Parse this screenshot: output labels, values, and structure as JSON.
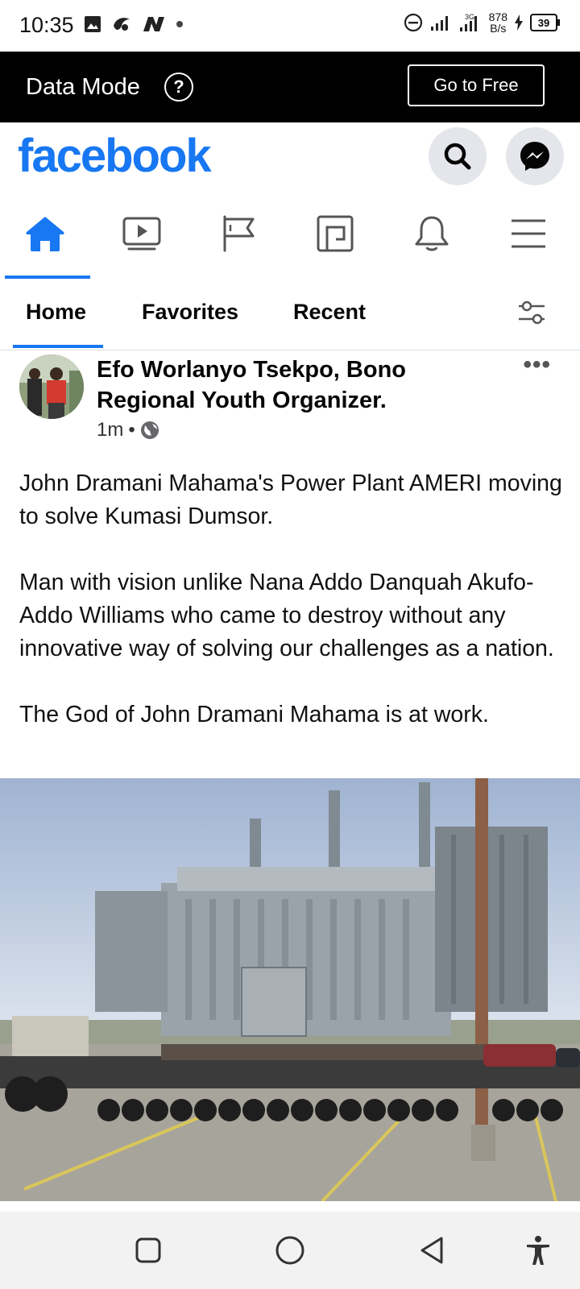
{
  "status_bar": {
    "time": "10:35",
    "network_speed": "878",
    "network_speed_unit": "B/s",
    "battery": "39",
    "signal_label": "3G"
  },
  "data_mode": {
    "label": "Data Mode",
    "help_symbol": "?",
    "button_label": "Go to Free"
  },
  "header": {
    "logo": "facebook",
    "search_icon": "search-icon",
    "messenger_icon": "messenger-icon",
    "brand_color": "#1877f2"
  },
  "nav_tabs": [
    {
      "name": "home",
      "icon": "home-icon",
      "active": true
    },
    {
      "name": "watch",
      "icon": "video-icon",
      "active": false
    },
    {
      "name": "pages",
      "icon": "flag-icon",
      "active": false
    },
    {
      "name": "feeds",
      "icon": "feeds-icon",
      "active": false
    },
    {
      "name": "notifications",
      "icon": "bell-icon",
      "active": false
    },
    {
      "name": "menu",
      "icon": "menu-icon",
      "active": false
    }
  ],
  "filters": {
    "items": [
      "Home",
      "Favorites",
      "Recent"
    ],
    "selected": "Home"
  },
  "post": {
    "author": "Efo Worlanyo Tsekpo, Bono Regional Youth Organizer.",
    "time": "1m",
    "separator": "•",
    "audience_icon": "globe-icon",
    "paragraphs": [
      "John Dramani Mahama's Power Plant AMERI moving to solve Kumasi Dumsor.",
      "Man with vision unlike Nana Addo Danquah Akufo-Addo Williams who came to destroy without any innovative way of solving our challenges as a nation.",
      "The God of John Dramani Mahama is at work."
    ],
    "more_symbol": "•••"
  },
  "system_nav": {
    "recents_icon": "square-icon",
    "home_icon": "circle-icon",
    "back_icon": "triangle-back-icon",
    "accessibility_icon": "accessibility-icon"
  }
}
